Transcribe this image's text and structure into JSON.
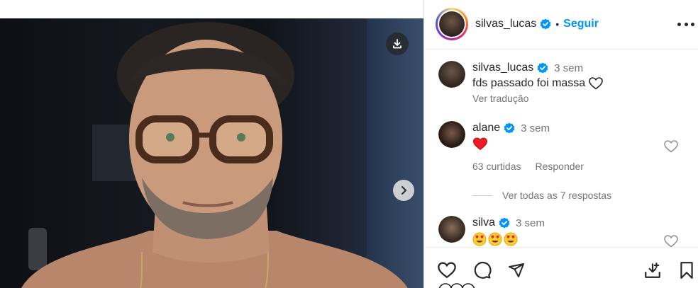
{
  "post": {
    "author": "silvas_lucas",
    "follow_label": "Seguir",
    "separator": "•"
  },
  "caption": {
    "user": "silvas_lucas",
    "time": "3 sem",
    "text": "fds passado foi massa",
    "translate": "Ver tradução"
  },
  "comments": [
    {
      "user": "alane",
      "time": "3 sem",
      "text_emoji": "heart",
      "likes": "63 curtidas",
      "reply_label": "Responder"
    },
    {
      "user": "silva",
      "time": "3 sem",
      "text_emoji": "heart-eyes x3"
    }
  ],
  "replies": {
    "label": "Ver todas as 7 respostas"
  },
  "icons": {
    "download": "download-icon",
    "next": "chevron-right-icon",
    "more": "more-icon",
    "like": "heart-icon",
    "comment": "comment-icon",
    "share": "send-icon",
    "save_to_collection": "download-tray-icon",
    "save": "bookmark-icon",
    "verified": "verified-badge-icon"
  },
  "colors": {
    "accent": "#0095f6",
    "verified": "#0095f6",
    "heart_red": "#ed1c24",
    "muted": "#737373",
    "text": "#262626"
  }
}
